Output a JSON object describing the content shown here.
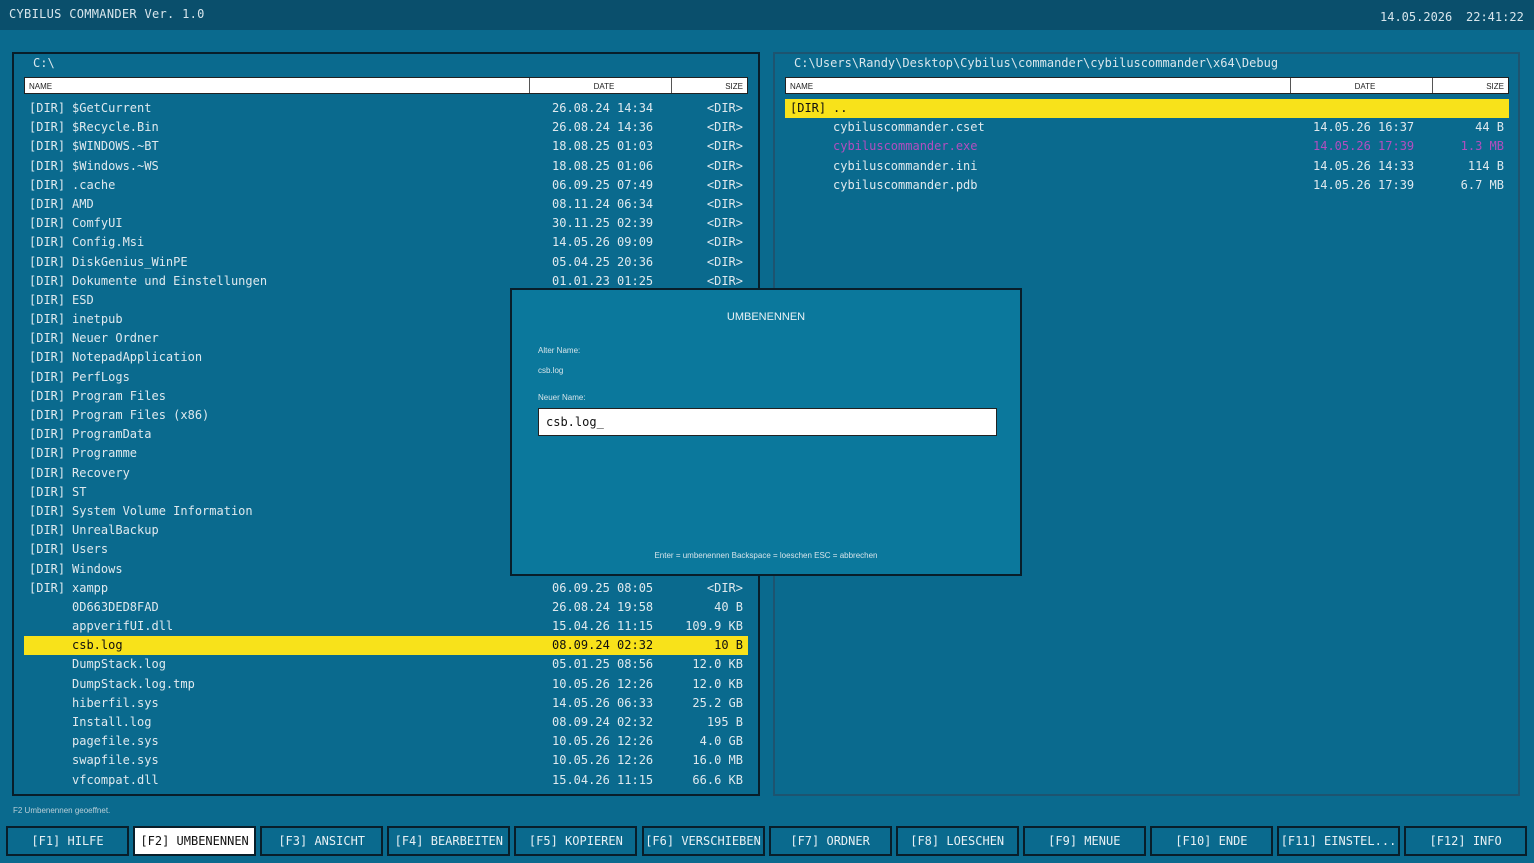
{
  "app": {
    "title": "CYBILUS COMMANDER Ver. 1.0",
    "date": "14.05.2026",
    "time": "22:41:22"
  },
  "columns": {
    "name": "NAME",
    "date": "DATE",
    "size": "SIZE"
  },
  "left_panel": {
    "path": "C:\\",
    "files": [
      {
        "tag": "[DIR]",
        "name": "$GetCurrent",
        "date": "26.08.24 14:34",
        "size": "<DIR>"
      },
      {
        "tag": "[DIR]",
        "name": "$Recycle.Bin",
        "date": "26.08.24 14:36",
        "size": "<DIR>"
      },
      {
        "tag": "[DIR]",
        "name": "$WINDOWS.~BT",
        "date": "18.08.25 01:03",
        "size": "<DIR>"
      },
      {
        "tag": "[DIR]",
        "name": "$Windows.~WS",
        "date": "18.08.25 01:06",
        "size": "<DIR>"
      },
      {
        "tag": "[DIR]",
        "name": ".cache",
        "date": "06.09.25 07:49",
        "size": "<DIR>"
      },
      {
        "tag": "[DIR]",
        "name": "AMD",
        "date": "08.11.24 06:34",
        "size": "<DIR>"
      },
      {
        "tag": "[DIR]",
        "name": "ComfyUI",
        "date": "30.11.25 02:39",
        "size": "<DIR>"
      },
      {
        "tag": "[DIR]",
        "name": "Config.Msi",
        "date": "14.05.26 09:09",
        "size": "<DIR>"
      },
      {
        "tag": "[DIR]",
        "name": "DiskGenius_WinPE",
        "date": "05.04.25 20:36",
        "size": "<DIR>"
      },
      {
        "tag": "[DIR]",
        "name": "Dokumente und Einstellungen",
        "date": "01.01.23 01:25",
        "size": "<DIR>"
      },
      {
        "tag": "[DIR]",
        "name": "ESD",
        "date": "",
        "size": ""
      },
      {
        "tag": "[DIR]",
        "name": "inetpub",
        "date": "",
        "size": ""
      },
      {
        "tag": "[DIR]",
        "name": "Neuer Ordner",
        "date": "",
        "size": ""
      },
      {
        "tag": "[DIR]",
        "name": "NotepadApplication",
        "date": "",
        "size": ""
      },
      {
        "tag": "[DIR]",
        "name": "PerfLogs",
        "date": "",
        "size": ""
      },
      {
        "tag": "[DIR]",
        "name": "Program Files",
        "date": "",
        "size": ""
      },
      {
        "tag": "[DIR]",
        "name": "Program Files (x86)",
        "date": "",
        "size": ""
      },
      {
        "tag": "[DIR]",
        "name": "ProgramData",
        "date": "",
        "size": ""
      },
      {
        "tag": "[DIR]",
        "name": "Programme",
        "date": "",
        "size": ""
      },
      {
        "tag": "[DIR]",
        "name": "Recovery",
        "date": "",
        "size": ""
      },
      {
        "tag": "[DIR]",
        "name": "ST",
        "date": "",
        "size": ""
      },
      {
        "tag": "[DIR]",
        "name": "System Volume Information",
        "date": "",
        "size": ""
      },
      {
        "tag": "[DIR]",
        "name": "UnrealBackup",
        "date": "",
        "size": ""
      },
      {
        "tag": "[DIR]",
        "name": "Users",
        "date": "",
        "size": ""
      },
      {
        "tag": "[DIR]",
        "name": "Windows",
        "date": "",
        "size": ""
      },
      {
        "tag": "[DIR]",
        "name": "xampp",
        "date": "06.09.25 08:05",
        "size": "<DIR>"
      },
      {
        "tag": "",
        "name": "0D663DED8FAD",
        "date": "26.08.24 19:58",
        "size": "40 B"
      },
      {
        "tag": "",
        "name": "appverifUI.dll",
        "date": "15.04.26 11:15",
        "size": "109.9 KB"
      },
      {
        "tag": "",
        "name": "csb.log",
        "date": "08.09.24 02:32",
        "size": "10 B",
        "selected": true
      },
      {
        "tag": "",
        "name": "DumpStack.log",
        "date": "05.01.25 08:56",
        "size": "12.0 KB"
      },
      {
        "tag": "",
        "name": "DumpStack.log.tmp",
        "date": "10.05.26 12:26",
        "size": "12.0 KB"
      },
      {
        "tag": "",
        "name": "hiberfil.sys",
        "date": "14.05.26 06:33",
        "size": "25.2 GB"
      },
      {
        "tag": "",
        "name": "Install.log",
        "date": "08.09.24 02:32",
        "size": "195 B"
      },
      {
        "tag": "",
        "name": "pagefile.sys",
        "date": "10.05.26 12:26",
        "size": "4.0 GB"
      },
      {
        "tag": "",
        "name": "swapfile.sys",
        "date": "10.05.26 12:26",
        "size": "16.0 MB"
      },
      {
        "tag": "",
        "name": "vfcompat.dll",
        "date": "15.04.26 11:15",
        "size": "66.6 KB"
      }
    ]
  },
  "right_panel": {
    "path": "C:\\Users\\Randy\\Desktop\\Cybilus\\commander\\cybiluscommander\\x64\\Debug",
    "files": [
      {
        "tag": "[DIR]",
        "name": "..",
        "date": "",
        "size": "",
        "selected": true
      },
      {
        "tag": "",
        "name": "cybiluscommander.cset",
        "date": "14.05.26 16:37",
        "size": "44 B"
      },
      {
        "tag": "",
        "name": "cybiluscommander.exe",
        "date": "14.05.26 17:39",
        "size": "1.3 MB",
        "exe": true
      },
      {
        "tag": "",
        "name": "cybiluscommander.ini",
        "date": "14.05.26 14:33",
        "size": "114 B"
      },
      {
        "tag": "",
        "name": "cybiluscommander.pdb",
        "date": "14.05.26 17:39",
        "size": "6.7 MB"
      }
    ]
  },
  "dialog": {
    "title": "UMBENENNEN",
    "old_label": "Alter Name:",
    "old_value": "csb.log",
    "new_label": "Neuer Name:",
    "new_value": "csb.log_",
    "hint": "Enter = umbenennen   Backspace = loeschen   ESC = abbrechen"
  },
  "status": "F2 Umbenennen geoeffnet.",
  "fkeys": [
    {
      "label": "[F1] HILFE"
    },
    {
      "label": "[F2] UMBENENNEN",
      "active": true
    },
    {
      "label": "[F3] ANSICHT"
    },
    {
      "label": "[F4] BEARBEITEN"
    },
    {
      "label": "[F5] KOPIEREN"
    },
    {
      "label": "[F6] VERSCHIEBEN"
    },
    {
      "label": "[F7] ORDNER"
    },
    {
      "label": "[F8] LOESCHEN"
    },
    {
      "label": "[F9] MENUE"
    },
    {
      "label": "[F10] ENDE"
    },
    {
      "label": "[F11] EINSTEL..."
    },
    {
      "label": "[F12] INFO"
    }
  ]
}
